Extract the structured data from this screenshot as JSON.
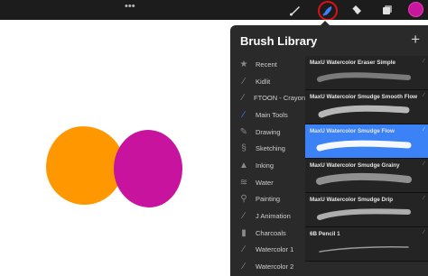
{
  "topbar": {
    "menu_dots": "•••",
    "tools": [
      "brush-tool",
      "smudge-tool",
      "eraser-tool",
      "layers-tool"
    ],
    "active_color": "#c8179c"
  },
  "library": {
    "title": "Brush Library",
    "add_label": "+",
    "sets": [
      {
        "label": "Recent",
        "icon": "star-icon"
      },
      {
        "label": "Kidlit",
        "icon": "brush-stroke-icon"
      },
      {
        "label": "FTOON - Crayon",
        "icon": "brush-stroke-icon"
      },
      {
        "label": "Main Tools",
        "icon": "brush-stroke-icon",
        "active": true
      },
      {
        "label": "Drawing",
        "icon": "pencil-icon"
      },
      {
        "label": "Sketching",
        "icon": "swirl-icon"
      },
      {
        "label": "Inking",
        "icon": "ink-drop-icon"
      },
      {
        "label": "Water",
        "icon": "water-icon"
      },
      {
        "label": "Painting",
        "icon": "paint-brush-icon"
      },
      {
        "label": "J Animation",
        "icon": "brush-stroke-icon"
      },
      {
        "label": "Charcoals",
        "icon": "charcoal-icon"
      },
      {
        "label": "Watercolor 1",
        "icon": "brush-stroke-icon"
      },
      {
        "label": "Watercolor 2",
        "icon": "brush-stroke-icon"
      }
    ],
    "brushes": [
      {
        "name": "MaxU Watercolor Eraser Simple"
      },
      {
        "name": "MaxU Watercolor Smudge Smooth Flow"
      },
      {
        "name": "MaxU Watercolor Smudge Flow",
        "selected": true
      },
      {
        "name": "MaxU Watercolor Smudge Grainy"
      },
      {
        "name": "MaxU Watercolor Smudge Drip"
      },
      {
        "name": "6B Pencil 1"
      }
    ]
  },
  "colors": {
    "accent": "#3b82f6",
    "orange": "#ff9800",
    "magenta": "#c8139e",
    "highlight_ring": "#dd1111"
  }
}
